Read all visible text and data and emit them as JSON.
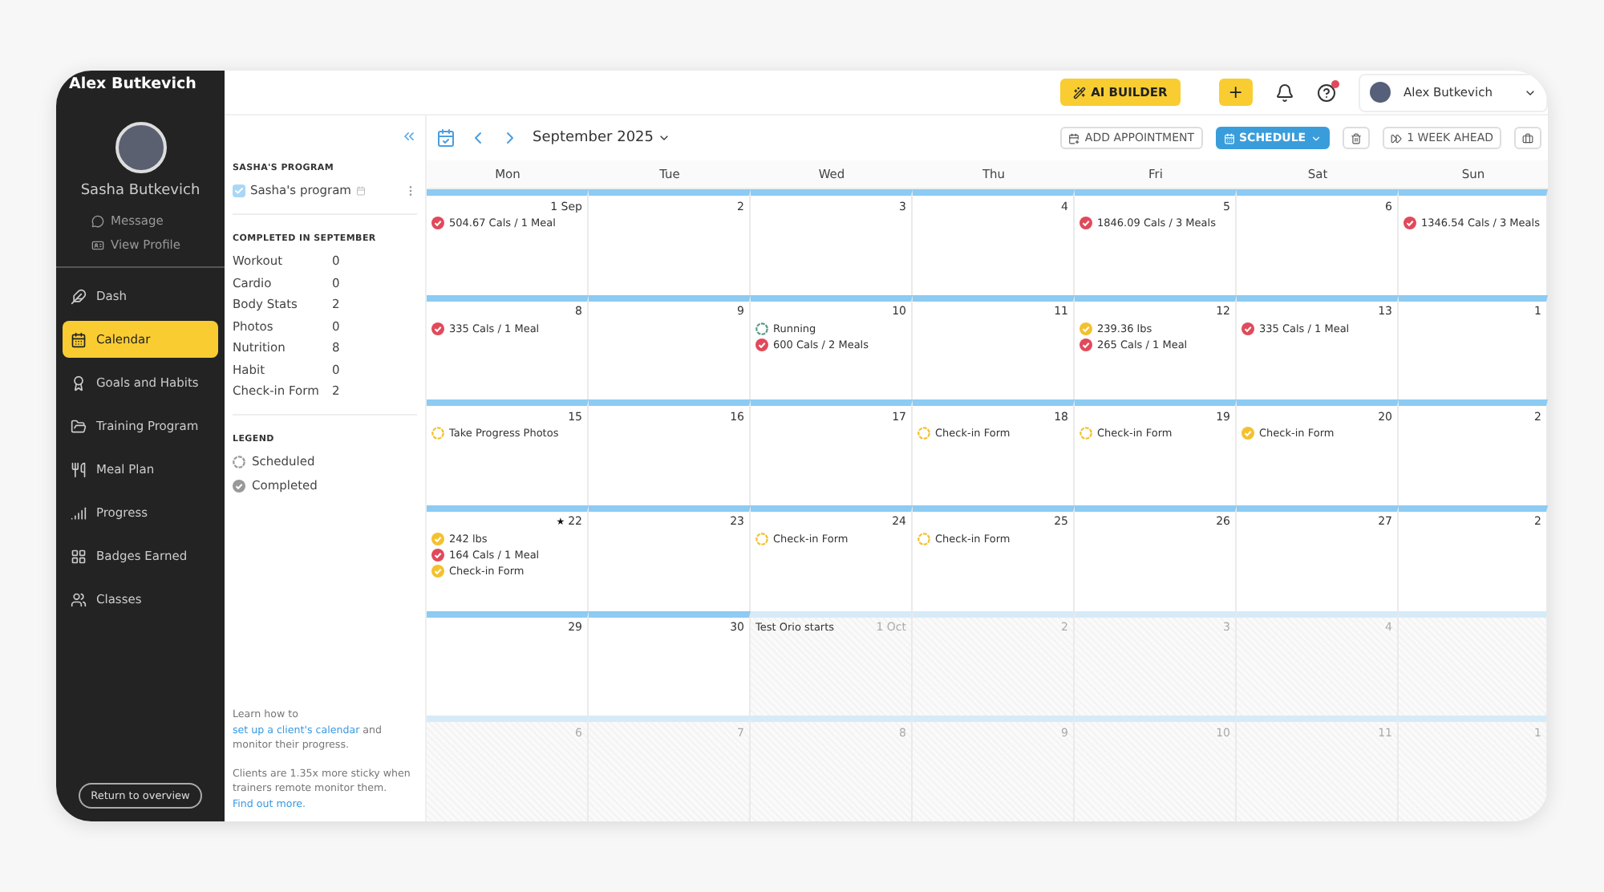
{
  "app_title": "Alex Butkevich",
  "client": {
    "name": "Sasha Butkevich",
    "actions": [
      "Message",
      "View Profile"
    ]
  },
  "nav": [
    {
      "label": "Dash",
      "selected": false
    },
    {
      "label": "Calendar",
      "selected": true
    },
    {
      "label": "Goals and Habits",
      "selected": false
    },
    {
      "label": "Training Program",
      "selected": false
    },
    {
      "label": "Meal Plan",
      "selected": false
    },
    {
      "label": "Progress",
      "selected": false
    },
    {
      "label": "Badges Earned",
      "selected": false
    },
    {
      "label": "Classes",
      "selected": false
    }
  ],
  "return_button": "Return to overview",
  "topbar": {
    "ai_button": "AI BUILDER",
    "add_button": "+",
    "user": "Alex Butkevich"
  },
  "program": {
    "heading": "SASHA'S PROGRAM",
    "item": {
      "label": "Sasha's program",
      "checked": true
    }
  },
  "completed": {
    "heading": "COMPLETED IN SEPTEMBER",
    "rows": [
      {
        "label": "Workout",
        "count": "0"
      },
      {
        "label": "Cardio",
        "count": "0"
      },
      {
        "label": "Body Stats",
        "count": "2"
      },
      {
        "label": "Photos",
        "count": "0"
      },
      {
        "label": "Nutrition",
        "count": "8"
      },
      {
        "label": "Habit",
        "count": "0"
      },
      {
        "label": "Check-in Form",
        "count": "2"
      }
    ]
  },
  "legend": {
    "heading": "LEGEND",
    "items": [
      {
        "label": "Scheduled",
        "completed": false
      },
      {
        "label": "Completed",
        "completed": true
      }
    ]
  },
  "help": [
    {
      "before": "Learn how to ",
      "link": "set up a client's calendar",
      "after": " and monitor their progress."
    },
    {
      "before": "Clients are 1.35x more sticky when trainers remote monitor them. ",
      "link": "Find out more."
    }
  ],
  "toolbar": {
    "month": "September 2025",
    "add_appointment": "ADD APPOINTMENT",
    "schedule": "SCHEDULE",
    "week_ahead": "1 WEEK AHEAD"
  },
  "calendar": {
    "weekdays": [
      "Mon",
      "Tue",
      "Wed",
      "Thu",
      "Fri",
      "Sat",
      "Sun"
    ],
    "weeks": [
      {
        "days": [
          {
            "number": "1 Sep",
            "other_month": false,
            "events": [
              {
                "kind": "status",
                "label": "504.67 Cals / 1 Meal",
                "color": "#e04a5b",
                "completed": true
              }
            ]
          },
          {
            "number": "2",
            "other_month": false
          },
          {
            "number": "3",
            "other_month": false
          },
          {
            "number": "4",
            "other_month": false
          },
          {
            "number": "5",
            "other_month": false,
            "events": [
              {
                "kind": "status",
                "label": "1846.09 Cals / 3 Meals",
                "color": "#e04a5b",
                "completed": true
              }
            ]
          },
          {
            "number": "6",
            "other_month": false
          },
          {
            "other_month": false,
            "events": [
              {
                "kind": "status",
                "label": "1346.54 Cals / 3 Meals",
                "color": "#e04a5b",
                "completed": true
              }
            ]
          }
        ]
      },
      {
        "days": [
          {
            "number": "8",
            "other_month": false,
            "events": [
              {
                "kind": "status",
                "label": "335 Cals / 1 Meal",
                "color": "#e04a5b",
                "completed": true
              }
            ]
          },
          {
            "number": "9",
            "other_month": false
          },
          {
            "number": "10",
            "other_month": false,
            "events": [
              {
                "kind": "status",
                "label": "Running",
                "color": "#5a9e86",
                "completed": false
              },
              {
                "kind": "status",
                "label": "600 Cals / 2 Meals",
                "color": "#e04a5b",
                "completed": true
              }
            ]
          },
          {
            "number": "11",
            "other_month": false
          },
          {
            "number": "12",
            "other_month": false,
            "events": [
              {
                "kind": "status",
                "label": "239.36 lbs",
                "color": "#f4c12e",
                "completed": true
              },
              {
                "kind": "status",
                "label": "265 Cals / 1 Meal",
                "color": "#e04a5b",
                "completed": true
              }
            ]
          },
          {
            "number": "13",
            "other_month": false,
            "events": [
              {
                "kind": "status",
                "label": "335 Cals / 1 Meal",
                "color": "#e04a5b",
                "completed": true
              }
            ]
          },
          {
            "number": "1",
            "other_month": false
          }
        ]
      },
      {
        "days": [
          {
            "number": "15",
            "other_month": false,
            "events": [
              {
                "kind": "status",
                "label": "Take Progress Photos",
                "color": "#f4c12e",
                "completed": false
              }
            ]
          },
          {
            "number": "16",
            "other_month": false
          },
          {
            "number": "17",
            "other_month": false
          },
          {
            "number": "18",
            "other_month": false,
            "events": [
              {
                "kind": "status",
                "label": "Check-in Form",
                "color": "#f4c12e",
                "completed": false
              }
            ]
          },
          {
            "number": "19",
            "other_month": false,
            "events": [
              {
                "kind": "status",
                "label": "Check-in Form",
                "color": "#f4c12e",
                "completed": false
              }
            ]
          },
          {
            "number": "20",
            "other_month": false,
            "events": [
              {
                "kind": "status",
                "label": "Check-in Form",
                "color": "#f4c12e",
                "completed": true
              }
            ]
          },
          {
            "number": "2",
            "other_month": false
          }
        ]
      },
      {
        "days": [
          {
            "number": "22",
            "marker": "★",
            "other_month": false,
            "events": [
              {
                "kind": "status",
                "label": "242 lbs",
                "color": "#f4c12e",
                "completed": true
              },
              {
                "kind": "status",
                "label": "164 Cals / 1 Meal",
                "color": "#e04a5b",
                "completed": true
              },
              {
                "kind": "status",
                "label": "Check-in Form",
                "color": "#f4c12e",
                "completed": true
              }
            ]
          },
          {
            "number": "23",
            "other_month": false
          },
          {
            "number": "24",
            "other_month": false,
            "events": [
              {
                "kind": "status",
                "label": "Check-in Form",
                "color": "#f4c12e",
                "completed": false
              }
            ]
          },
          {
            "number": "25",
            "other_month": false,
            "events": [
              {
                "kind": "status",
                "label": "Check-in Form",
                "color": "#f4c12e",
                "completed": false
              }
            ]
          },
          {
            "number": "26",
            "other_month": false
          },
          {
            "number": "27",
            "other_month": false
          },
          {
            "number": "2",
            "other_month": false
          }
        ]
      },
      {
        "days": [
          {
            "number": "29",
            "other_month": false
          },
          {
            "number": "30",
            "other_month": false
          },
          {
            "number": "1 Oct",
            "other_month": true,
            "events": [
              {
                "kind": "note",
                "label": "Test Orio starts"
              }
            ]
          },
          {
            "number": "2",
            "other_month": true
          },
          {
            "number": "3",
            "other_month": true
          },
          {
            "number": "4",
            "other_month": true
          },
          {
            "other_month": true
          }
        ]
      },
      {
        "days": [
          {
            "number": "6",
            "other_month": true
          },
          {
            "number": "7",
            "other_month": true
          },
          {
            "number": "8",
            "other_month": true
          },
          {
            "number": "9",
            "other_month": true
          },
          {
            "number": "10",
            "other_month": true
          },
          {
            "number": "11",
            "other_month": true
          },
          {
            "number": "1",
            "other_month": true
          }
        ]
      }
    ]
  }
}
